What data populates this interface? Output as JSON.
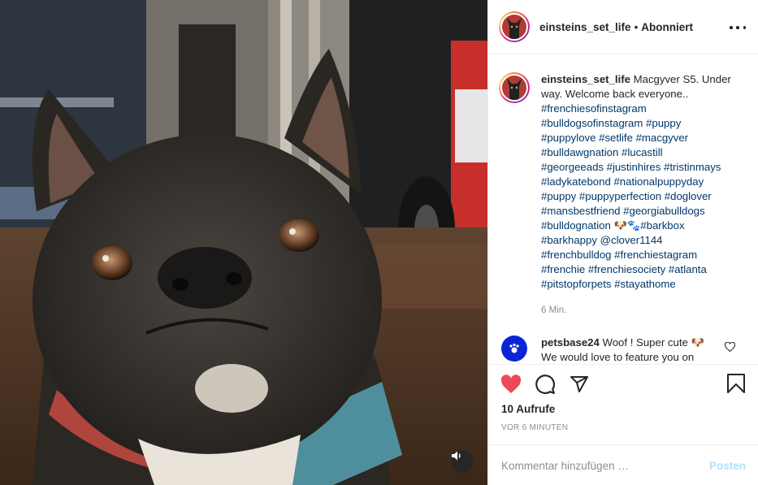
{
  "header": {
    "username": "einsteins_set_life",
    "separator": "•",
    "follow_status": "Abonniert"
  },
  "caption": {
    "username": "einsteins_set_life",
    "lines": [
      "Macgyver S5. Under",
      "way. Welcome back everyone.."
    ],
    "hashtag_lines": [
      "#frenchiesofinstagram",
      "#bulldogsofinstagram #puppy",
      "#puppylove #setlife #macgyver",
      "#bulldawgnation #lucastill",
      "#georgeeads #justinhires #tristinmays",
      "#ladykatebond #nationalpuppyday",
      "#puppy #puppyperfection #doglover",
      "#mansbestfriend #georgiabulldogs",
      "#bulldognation 🐶🐾#barkbox",
      "#barkhappy @clover1144",
      "#frenchbulldog #frenchiestagram",
      "#frenchie #frenchiesociety #atlanta",
      "#pitstopforpets #stayathome"
    ],
    "time": "6 Min."
  },
  "comment": {
    "username": "petsbase24",
    "text": "Woof ! Super cute 🐶",
    "text_line2": "We would love to feature you on"
  },
  "actions": {
    "like_icon": "heart-filled-icon",
    "comment_icon": "comment-icon",
    "share_icon": "paper-plane-icon",
    "save_icon": "bookmark-icon",
    "views": "10 Aufrufe",
    "posted_ago": "VOR 6 MINUTEN"
  },
  "add_comment": {
    "placeholder": "Kommentar hinzufügen …",
    "post_label": "Posten"
  },
  "media": {
    "sound_icon": "speaker-icon"
  },
  "colors": {
    "like": "#ed4956",
    "hashtag": "#00376b",
    "post_disabled": "#b2dffc",
    "meta": "#8e8e8e"
  }
}
